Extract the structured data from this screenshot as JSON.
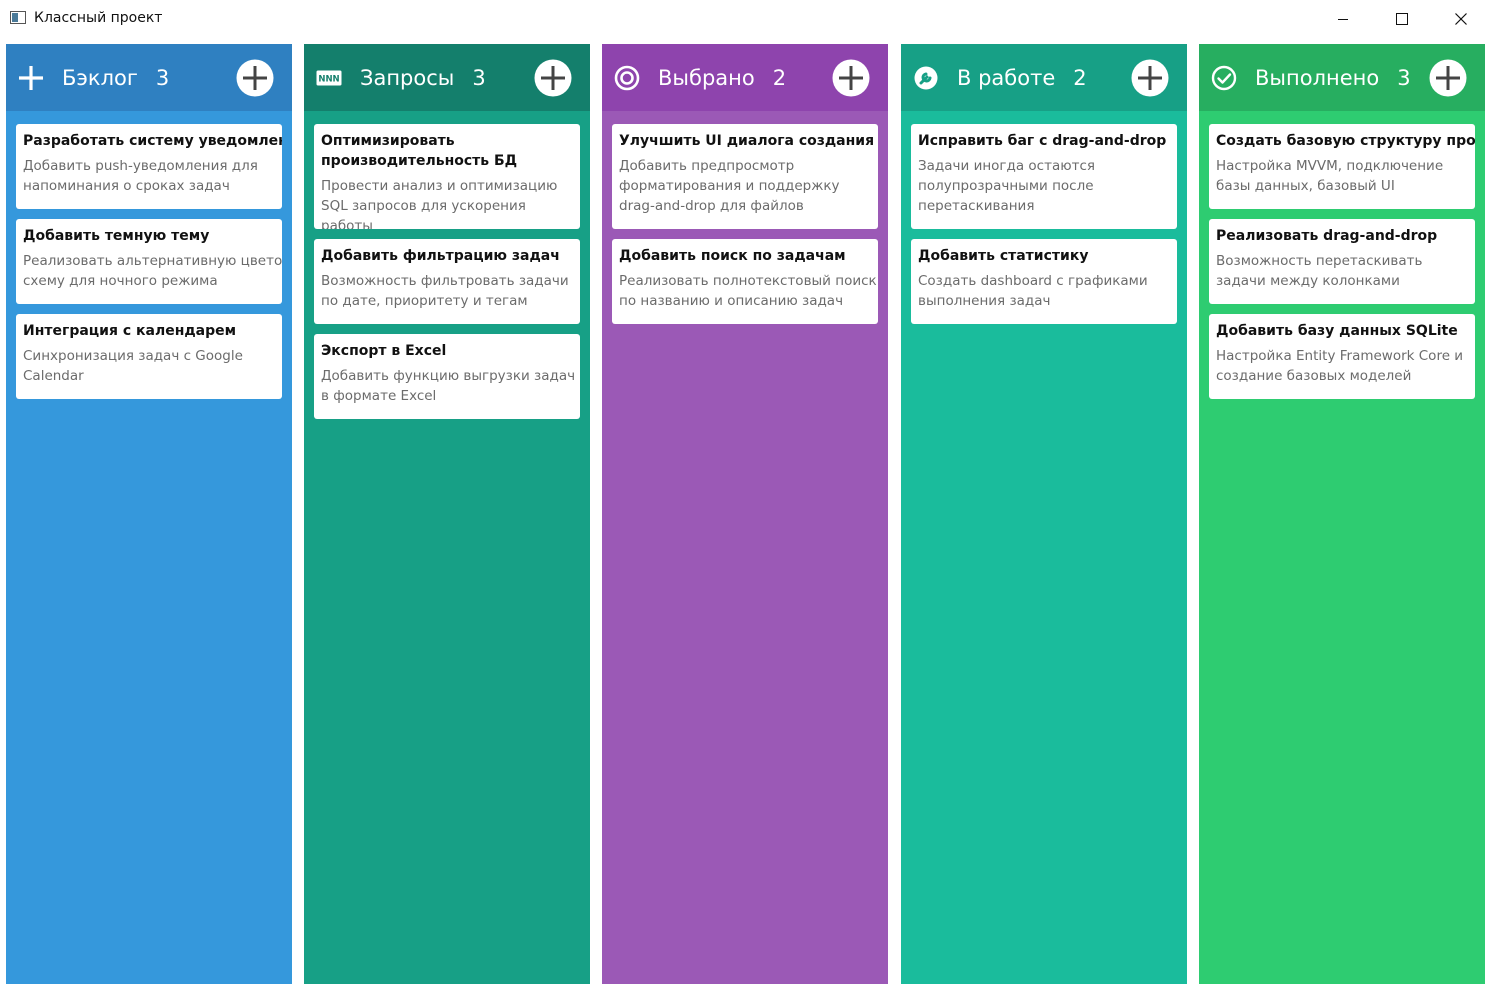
{
  "window": {
    "title": "Классный проект"
  },
  "columns": [
    {
      "title": "Бэклог",
      "count": "3",
      "icon": "plus-icon",
      "header_color": "#2f80c1",
      "body_color": "#3598dc",
      "cards": [
        {
          "title": "Разработать систему уведомлений",
          "desc": "Добавить push-уведомления для напоминания о сроках задач"
        },
        {
          "title": "Добавить темную тему",
          "desc": "Реализовать альтернативную цветовую схему для ночного режима"
        },
        {
          "title": "Интеграция с календарем",
          "desc": "Синхронизация задач с Google Calendar"
        }
      ]
    },
    {
      "title": "Запросы",
      "count": "3",
      "icon": "queue-icon",
      "header_color": "#147f6c",
      "body_color": "#17a086",
      "cards": [
        {
          "title": "Оптимизировать производительность БД",
          "desc": "Провести анализ и оптимизацию SQL запросов для ускорения работы"
        },
        {
          "title": "Добавить фильтрацию задач",
          "desc": "Возможность фильтровать задачи по дате, приоритету и тегам"
        },
        {
          "title": "Экспорт в Excel",
          "desc": "Добавить функцию выгрузки задач в формате Excel"
        }
      ]
    },
    {
      "title": "Выбрано",
      "count": "2",
      "icon": "target-icon",
      "header_color": "#8e44ad",
      "body_color": "#9b59b6",
      "cards": [
        {
          "title": "Улучшить UI диалога создания задач",
          "desc": "Добавить предпросмотр форматирования и поддержку drag-and-drop для файлов"
        },
        {
          "title": "Добавить поиск по задачам",
          "desc": "Реализовать полнотекстовый поиск по названию и описанию задач"
        }
      ]
    },
    {
      "title": "В работе",
      "count": "2",
      "icon": "wrench-icon",
      "header_color": "#17a086",
      "body_color": "#1abc9c",
      "cards": [
        {
          "title": "Исправить баг с drag-and-drop",
          "desc": "Задачи иногда остаются полупрозрачными после перетаскивания"
        },
        {
          "title": "Добавить статистику",
          "desc": "Создать dashboard с графиками выполнения задач"
        }
      ]
    },
    {
      "title": "Выполнено",
      "count": "3",
      "icon": "check-circle-icon",
      "header_color": "#27ae60",
      "body_color": "#2ecc71",
      "cards": [
        {
          "title": "Создать базовую структуру проекта",
          "desc": "Настройка MVVM, подключение базы данных, базовый UI"
        },
        {
          "title": "Реализовать drag-and-drop",
          "desc": "Возможность перетаскивать задачи между колонками"
        },
        {
          "title": "Добавить базу данных SQLite",
          "desc": "Настройка Entity Framework Core и создание базовых моделей"
        }
      ]
    }
  ]
}
